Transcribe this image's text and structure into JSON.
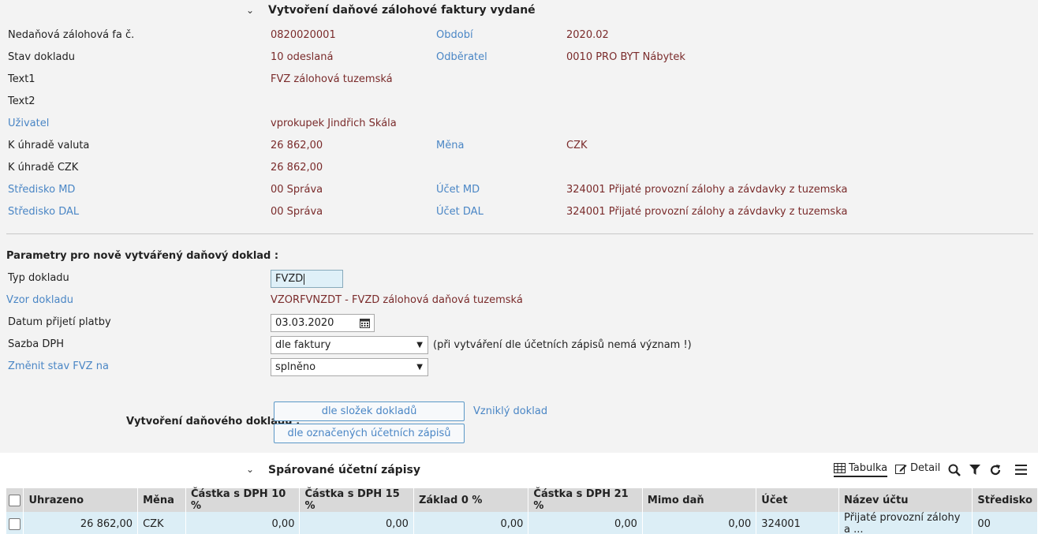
{
  "header": {
    "title": "Vytvoření daňové zálohové faktury vydané"
  },
  "info": {
    "rows": [
      {
        "label": "Nedaňová zálohová fa č.",
        "value": "0820020001",
        "label2": "Období",
        "value2": "2020.02"
      },
      {
        "label": "Stav dokladu",
        "value": "10 odeslaná",
        "label2": "Odběratel",
        "value2": "0010 PRO BYT Nábytek"
      },
      {
        "label": "Text1",
        "value": "FVZ zálohová tuzemská"
      },
      {
        "label": "Text2",
        "value": ""
      },
      {
        "label": "Uživatel",
        "value": "vprokupek Jindřich Skála"
      },
      {
        "label": "K úhradě valuta",
        "value": "26 862,00",
        "label2": "Měna",
        "value2": "CZK"
      },
      {
        "label": "K úhradě CZK",
        "value": "26 862,00"
      },
      {
        "label": "Středisko MD",
        "value": "00 Správa",
        "label2": "Účet MD",
        "value2": "324001 Přijaté provozní zálohy a závdavky z tuzemska"
      },
      {
        "label": "Středisko DAL",
        "value": "00 Správa",
        "label2": "Účet DAL",
        "value2": "324001 Přijaté provozní zálohy a závdavky z tuzemska"
      }
    ]
  },
  "params": {
    "title": "Parametry pro nově vytvářený daňový doklad :",
    "typ_label": "Typ dokladu",
    "typ_value": "FVZD",
    "vzor_label": "Vzor dokladu",
    "vzor_value": "VZORFVNZDT - FVZD zálohová daňová tuzemská",
    "datum_label": "Datum přijetí platby",
    "datum_value": "03.03.2020",
    "sazba_label": "Sazba DPH",
    "sazba_value": "dle faktury",
    "sazba_note": "(při vytváření dle účetních zápisů nemá význam !)",
    "zmenit_label": "Změnit stav FVZ na",
    "zmenit_value": "splněno"
  },
  "create": {
    "label": "Vytvoření daňového dokladu :",
    "btn1": "dle složek dokladů",
    "btn2": "dle označených účetních zápisů",
    "link": "Vzniklý doklad"
  },
  "paired": {
    "title": "Spárované účetní zápisy",
    "tab_table": "Tabulka",
    "tab_detail": "Detail",
    "columns": [
      "Uhrazeno",
      "Měna",
      "Částka s DPH 10 %",
      "Částka s DPH 15 %",
      "Základ 0 %",
      "Částka s DPH 21 %",
      "Mimo daň",
      "Účet",
      "Název účtu",
      "Středisko"
    ],
    "rows": [
      [
        "26 862,00",
        "CZK",
        "0,00",
        "0,00",
        "0,00",
        "0,00",
        "0,00",
        "324001",
        "Přijaté provozní zálohy a ...",
        "00"
      ]
    ]
  }
}
